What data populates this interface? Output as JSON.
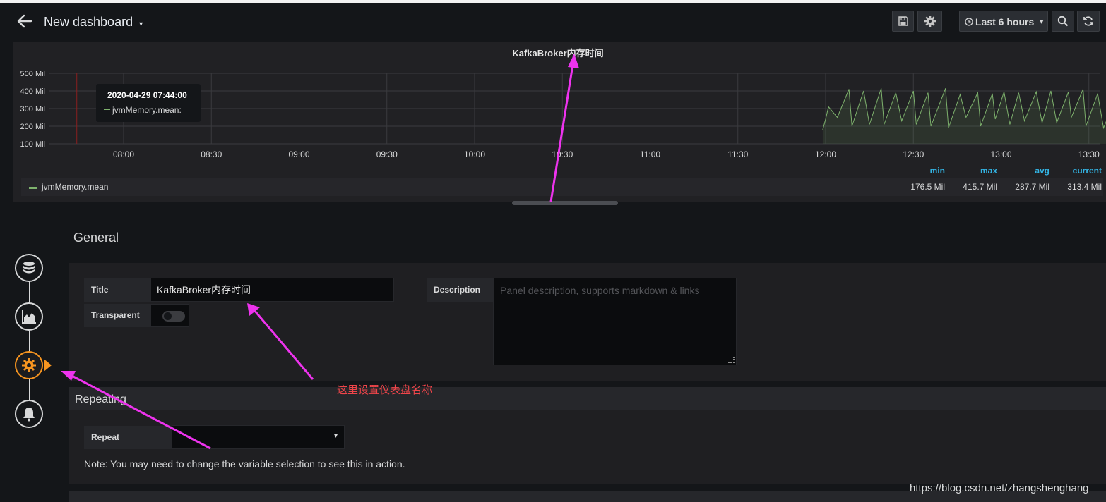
{
  "navbar": {
    "back_icon": "arrow-left-icon",
    "title": "New dashboard",
    "save_icon": "save-icon",
    "settings_icon": "gear-icon",
    "time_range": "Last 6 hours",
    "zoom_icon": "zoom-out-icon",
    "refresh_icon": "refresh-icon"
  },
  "panel": {
    "title": "KafkaBroker内存时间",
    "tooltip": {
      "time": "2020-04-29 07:44:00",
      "series": "jvmMemory.mean:"
    },
    "legend": {
      "headers": [
        "min",
        "max",
        "avg",
        "current"
      ],
      "series_name": "jvmMemory.mean",
      "values": [
        "176.5 Mil",
        "415.7 Mil",
        "287.7 Mil",
        "313.4 Mil"
      ]
    }
  },
  "chart_data": {
    "type": "line",
    "title": "KafkaBroker内存时间",
    "y_ticks": [
      "500 Mil",
      "400 Mil",
      "300 Mil",
      "200 Mil",
      "100 Mil"
    ],
    "x_ticks": [
      "08:00",
      "08:30",
      "09:00",
      "09:30",
      "10:00",
      "10:30",
      "11:00",
      "11:30",
      "12:00",
      "12:30",
      "13:00",
      "13:30"
    ],
    "ylim": [
      100,
      500
    ],
    "series": [
      {
        "name": "jvmMemory.mean",
        "color": "#7eb26d",
        "x": [
          "11:59",
          "12:00",
          "12:01",
          "12:04",
          "12:08",
          "12:09",
          "12:13",
          "12:15",
          "12:19",
          "12:20",
          "12:24",
          "12:26",
          "12:30",
          "12:31",
          "12:35",
          "12:36",
          "12:41",
          "12:42",
          "12:46",
          "12:48",
          "12:52",
          "12:53",
          "12:57",
          "12:58",
          "13:01",
          "13:03",
          "13:06",
          "13:08",
          "13:12",
          "13:14",
          "13:17",
          "13:19",
          "13:23",
          "13:24",
          "13:28",
          "13:29",
          "13:33",
          "13:35",
          "13:38"
        ],
        "values": [
          180,
          240,
          310,
          250,
          410,
          200,
          400,
          210,
          415,
          210,
          390,
          230,
          400,
          210,
          390,
          200,
          415,
          190,
          380,
          250,
          390,
          200,
          385,
          240,
          395,
          210,
          390,
          230,
          395,
          220,
          400,
          220,
          395,
          250,
          410,
          200,
          385,
          190,
          310
        ]
      }
    ],
    "grid": true,
    "legend": "bottom"
  },
  "sidebar": {
    "icons": [
      "database-icon",
      "chart-area-icon",
      "cog-wrench-icon",
      "bell-icon"
    ]
  },
  "editor": {
    "general": {
      "heading": "General",
      "title_label": "Title",
      "title_value": "KafkaBroker内存时间",
      "transparent_label": "Transparent",
      "description_label": "Description",
      "description_placeholder": "Panel description, supports markdown & links"
    },
    "repeating": {
      "heading": "Repeating",
      "repeat_label": "Repeat",
      "note": "Note: You may need to change the variable selection to see this in action."
    }
  },
  "annotation": {
    "text": "这里设置仪表盘名称",
    "color": "#ee33ee"
  },
  "watermark": "https://blog.csdn.net/zhangshenghang"
}
